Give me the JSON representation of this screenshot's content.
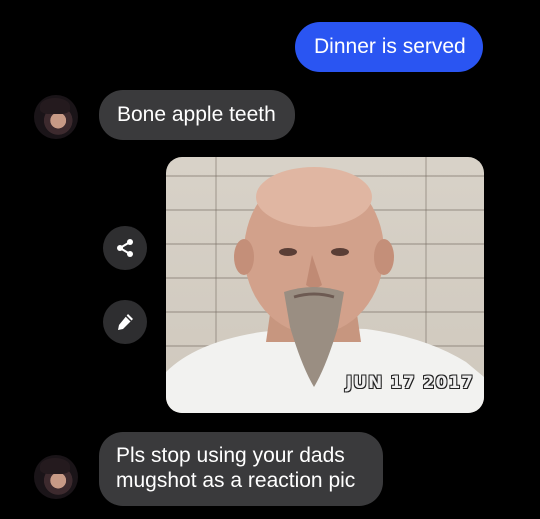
{
  "conversation": {
    "messages": [
      {
        "sender": "me",
        "text": "Dinner is served"
      },
      {
        "sender": "them",
        "text": "Bone apple teeth"
      },
      {
        "sender": "them",
        "type": "photo",
        "photo_stamp": "JUN 17 2017"
      },
      {
        "sender": "them",
        "text": "Pls stop using your dads mugshot as a reaction pic"
      }
    ]
  },
  "actions": {
    "share_icon": "share-icon",
    "edit_icon": "pencil-icon"
  },
  "colors": {
    "background": "#000000",
    "sent_bubble": "#2a55f2",
    "received_bubble": "#3a3a3c",
    "text": "#ffffff"
  }
}
